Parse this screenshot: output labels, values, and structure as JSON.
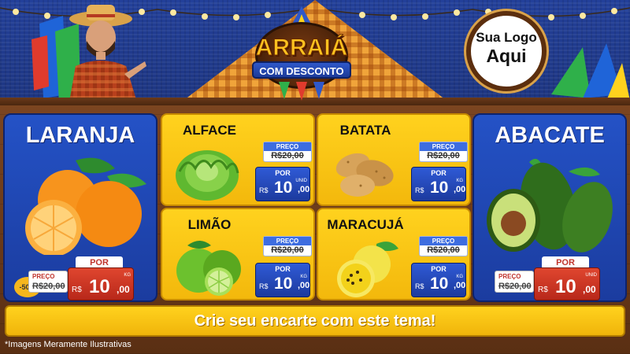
{
  "header": {
    "title_main": "ARRAIÁ",
    "title_sub": "COM DESCONTO",
    "logo_line1": "Sua Logo",
    "logo_line2": "Aqui"
  },
  "products": {
    "laranja": {
      "name": "LARANJA",
      "discount": "-50%",
      "old_label": "PREÇO",
      "old_price": "R$20,00",
      "por": "POR",
      "currency": "R$",
      "amount": "10",
      "decimals": ",00",
      "unit": "KG"
    },
    "alface": {
      "name": "ALFACE",
      "old_label": "PREÇO",
      "old_price": "R$20,00",
      "por": "POR",
      "currency": "R$",
      "amount": "10",
      "decimals": ",00",
      "unit": "UNID"
    },
    "batata": {
      "name": "BATATA",
      "old_label": "PREÇO",
      "old_price": "R$20,00",
      "por": "POR",
      "currency": "R$",
      "amount": "10",
      "decimals": ",00",
      "unit": "KG"
    },
    "limao": {
      "name": "LIMÃO",
      "old_label": "PREÇO",
      "old_price": "R$20,00",
      "por": "POR",
      "currency": "R$",
      "amount": "10",
      "decimals": ",00",
      "unit": "KG"
    },
    "maracuja": {
      "name": "MARACUJÁ",
      "old_label": "PREÇO",
      "old_price": "R$20,00",
      "por": "POR",
      "currency": "R$",
      "amount": "10",
      "decimals": ",00",
      "unit": "KG"
    },
    "abacate": {
      "name": "ABACATE",
      "old_label": "PREÇO",
      "old_price": "R$20,00",
      "por": "POR",
      "currency": "R$",
      "amount": "10",
      "decimals": ",00",
      "unit": "UNID"
    }
  },
  "cta": "Crie seu encarte com este tema!",
  "footer_note": "*Imagens Meramente Ilustrativas",
  "colors": {
    "blue": "#2452c6",
    "yellow": "#ffd21e",
    "wood": "#6b3a1a",
    "red": "#c0332b"
  }
}
